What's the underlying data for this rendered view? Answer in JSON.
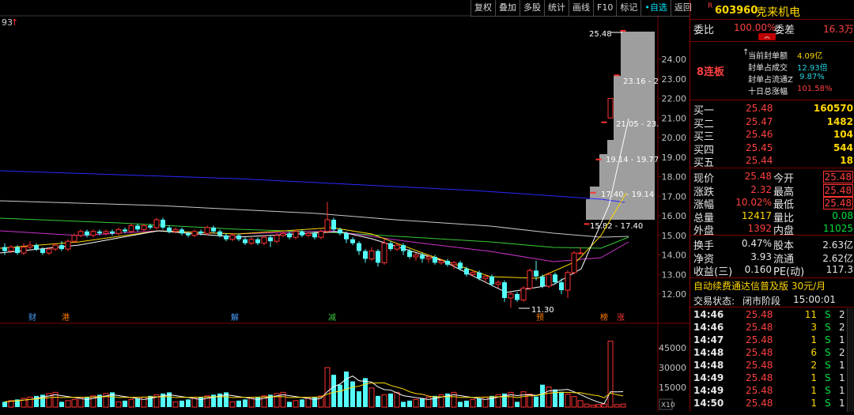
{
  "toolbar": {
    "items": [
      "复权",
      "叠加",
      "多股",
      "统计",
      "画线",
      "F10",
      "标记",
      "•自选",
      "返回"
    ]
  },
  "chart": {
    "top_left_price": "93",
    "y_axis_price_labels": [
      "24.00",
      "23.00",
      "22.00",
      "21.00",
      "20.00",
      "19.00",
      "18.00",
      "17.00",
      "16.00",
      "15.00",
      "14.00",
      "13.00",
      "12.00"
    ],
    "y_axis_volume_labels": [
      "45000",
      "30000",
      "15000"
    ],
    "volume_unit": "X10",
    "peak_label": "25.48",
    "low_label": "11.30",
    "range_labels": [
      "23.16 - 2",
      "21.05 - 23.",
      "19.14 - 19.77",
      "17.40 - 19.14",
      "15.82 - 17.40"
    ],
    "event_markers": [
      "财",
      "港",
      "解",
      "减",
      "预",
      "榜",
      "涨"
    ]
  },
  "quote": {
    "r_badge": "R",
    "code": "603960",
    "name": "克来机电",
    "weibi_label": "委比",
    "weibi_value": "100.00%",
    "weicha_label": "委差",
    "weicha_value": "16.3万",
    "limit_up_streak": "8连板",
    "seal_amount_label": "当前封单额",
    "seal_amount_value": "4.09亿",
    "seal_vs_turnover_label": "封单占成交",
    "seal_vs_turnover_value": "12.93倍",
    "seal_vs_float_label": "封单占流通Z",
    "seal_vs_float_value": "9.87%",
    "ten_day_gain_label": "十日总涨幅",
    "ten_day_gain_value": "101.58%",
    "bids": [
      {
        "label": "买一",
        "price": "25.48",
        "volume": "160570"
      },
      {
        "label": "买二",
        "price": "25.47",
        "volume": "1482"
      },
      {
        "label": "买三",
        "price": "25.46",
        "volume": "104"
      },
      {
        "label": "买四",
        "price": "25.45",
        "volume": "544"
      },
      {
        "label": "买五",
        "price": "25.44",
        "volume": "18"
      }
    ],
    "stats_left": [
      {
        "label": "现价",
        "value": "25.48"
      },
      {
        "label": "涨跌",
        "value": "2.32"
      },
      {
        "label": "涨幅",
        "value": "10.02%"
      },
      {
        "label": "总量",
        "value": "12417"
      },
      {
        "label": "外盘",
        "value": "1392"
      }
    ],
    "stats_right": [
      {
        "label": "今开",
        "value": "25.48"
      },
      {
        "label": "最高",
        "value": "25.48"
      },
      {
        "label": "最低",
        "value": "25.48"
      },
      {
        "label": "量比",
        "value": "0.08"
      },
      {
        "label": "内盘",
        "value": "11025"
      }
    ],
    "fundamentals": [
      {
        "l1": "换手",
        "v1": "0.47%",
        "l2": "股本",
        "v2": "2.63亿"
      },
      {
        "l1": "净资",
        "v1": "3.93",
        "l2": "流通",
        "v2": "2.62亿"
      },
      {
        "l1": "收益(三)",
        "v1": "0.160",
        "l2": "PE(动)",
        "v2": "117.3"
      }
    ],
    "ad_text": "自动续费通达信普及版 30元/月",
    "status_label": "交易状态:",
    "status_value": "闭市阶段",
    "status_time": "15:00:01",
    "ticks": [
      {
        "time": "14:46",
        "price": "25.48",
        "vol": "11",
        "bs": "S",
        "n": "2"
      },
      {
        "time": "14:46",
        "price": "25.48",
        "vol": "3",
        "bs": "S",
        "n": "2"
      },
      {
        "time": "14:47",
        "price": "25.48",
        "vol": "1",
        "bs": "S",
        "n": "1"
      },
      {
        "time": "14:48",
        "price": "25.48",
        "vol": "6",
        "bs": "S",
        "n": "2"
      },
      {
        "time": "14:48",
        "price": "25.48",
        "vol": "2",
        "bs": "S",
        "n": "1"
      },
      {
        "time": "14:49",
        "price": "25.48",
        "vol": "1",
        "bs": "S",
        "n": "1"
      },
      {
        "time": "14:49",
        "price": "25.48",
        "vol": "1",
        "bs": "S",
        "n": "1"
      },
      {
        "time": "14:50",
        "price": "25.48",
        "vol": "1",
        "bs": "S",
        "n": "1"
      }
    ]
  },
  "colors": {
    "up": "#ff3232",
    "down": "#54fcfc",
    "bg": "#000000",
    "accent": "#ffd800"
  }
}
